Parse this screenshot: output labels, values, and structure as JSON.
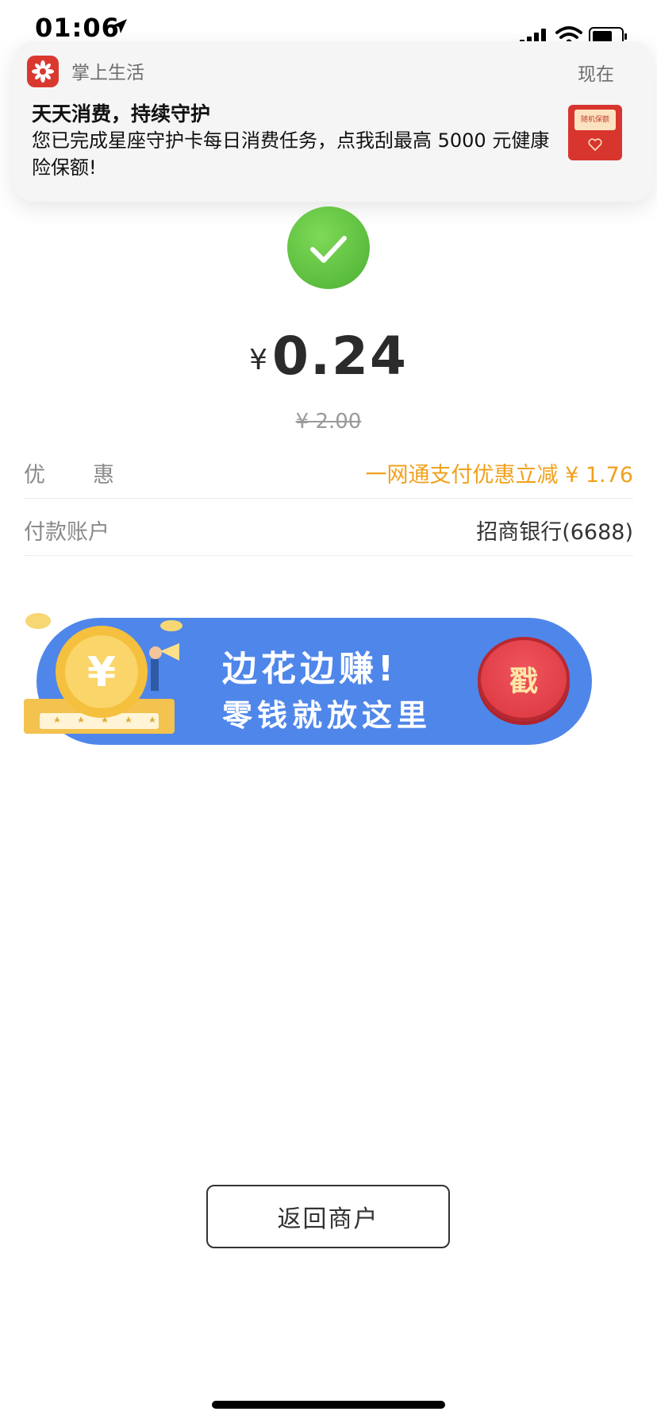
{
  "status_bar": {
    "time": "01:06",
    "icons": [
      "location-arrow-icon",
      "signal-icon",
      "wifi-icon",
      "battery-icon"
    ]
  },
  "notification": {
    "app_name": "掌上生活",
    "time": "现在",
    "title": "天天消费，持续守护",
    "body": "您已完成星座守护卡每日消费任务，点我刮最高 5000 元健康险保额!",
    "thumbnail_label": "随机保额",
    "accent_color": "#d9382f"
  },
  "payment": {
    "status_icon": "check-icon",
    "currency_symbol": "¥",
    "amount": "0.24",
    "original_amount": "¥ 2.00"
  },
  "details": [
    {
      "label": "优惠",
      "value": "一网通支付优惠立减 ¥ 1.76",
      "value_color": "#f0a11d"
    },
    {
      "label": "付款账户",
      "value": "招商银行(6688)"
    }
  ],
  "promo_banner": {
    "line1": "边花边赚!",
    "line2": "零钱就放这里",
    "button_label": "戳",
    "background_color": "#4f86ea"
  },
  "actions": {
    "return_label": "返回商户"
  }
}
